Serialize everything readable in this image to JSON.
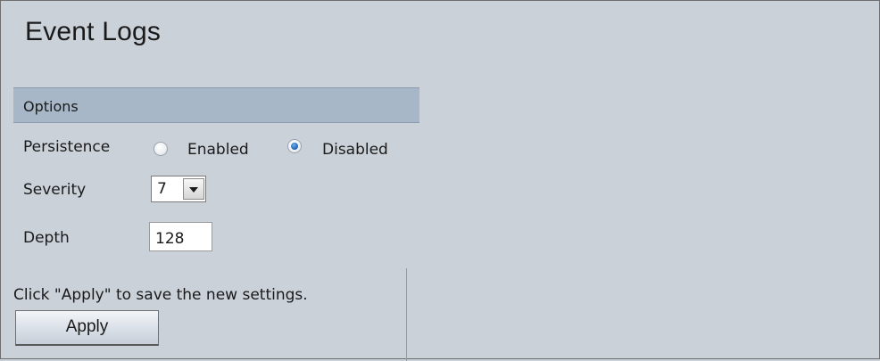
{
  "page": {
    "title": "Event Logs"
  },
  "options": {
    "header": "Options",
    "persistence": {
      "label": "Persistence",
      "options": [
        {
          "label": "Enabled",
          "checked": false
        },
        {
          "label": "Disabled",
          "checked": true
        }
      ]
    },
    "severity": {
      "label": "Severity",
      "value": "7"
    },
    "depth": {
      "label": "Depth",
      "value": "128"
    }
  },
  "footer": {
    "hint": "Click \"Apply\" to save the new settings.",
    "apply_label": "Apply"
  },
  "icons": {
    "severity_dropdown": "chevron-down-icon"
  },
  "colors": {
    "background": "#cbd1d9",
    "panel_header": "#a7b7c8",
    "radio_selected": "#1d5fae"
  }
}
